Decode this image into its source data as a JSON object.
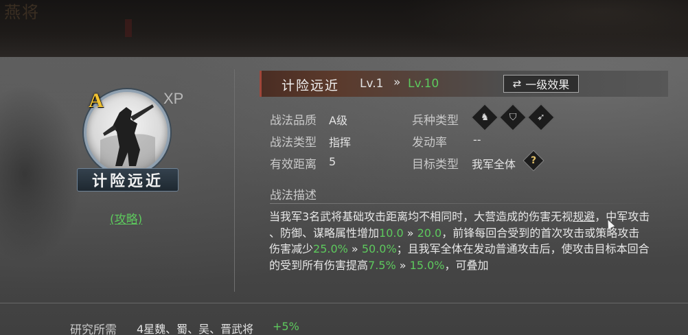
{
  "background": {
    "ghost_title": "燕将"
  },
  "skill": {
    "grade_letter": "A",
    "xp_label": "XP",
    "name": "计险远近",
    "guide_link": "(攻略)"
  },
  "header": {
    "title": "计险远近",
    "level_current": "Lv.1",
    "level_arrow": "»",
    "level_max": "Lv.10",
    "effect_button": {
      "icon": "swap-icon",
      "glyph": "⇄",
      "label": "一级效果"
    }
  },
  "attributes": {
    "quality_label": "战法品质",
    "quality_value": "A级",
    "type_label": "战法类型",
    "type_value": "指挥",
    "range_label": "有效距离",
    "range_value": "5",
    "troop_label": "兵种类型",
    "troop_icons": [
      {
        "name": "cavalry-icon",
        "glyph": "♞"
      },
      {
        "name": "shield-icon",
        "glyph": "⛉"
      },
      {
        "name": "bow-icon",
        "glyph": "➶"
      }
    ],
    "rate_label": "发动率",
    "rate_value": "--",
    "target_label": "目标类型",
    "target_value": "我军全体",
    "help_glyph": "?"
  },
  "description": {
    "title": "战法描述",
    "lines": [
      [
        {
          "t": "当我军3名武将基础攻击距离均不相同时，大营造成的伤害无视",
          "c": "n"
        },
        {
          "t": "规避",
          "c": "u"
        },
        {
          "t": "，中军攻击",
          "c": "n"
        }
      ],
      [
        {
          "t": "、防御、谋略属性增加",
          "c": "n"
        },
        {
          "t": "10.0",
          "c": "g"
        },
        {
          "t": " » ",
          "c": "n"
        },
        {
          "t": "20.0",
          "c": "g"
        },
        {
          "t": "，前锋每回合受到的首次攻击或策略攻击",
          "c": "n"
        }
      ],
      [
        {
          "t": "伤害减少",
          "c": "n"
        },
        {
          "t": "25.0%",
          "c": "g"
        },
        {
          "t": " » ",
          "c": "n"
        },
        {
          "t": "50.0%",
          "c": "g"
        },
        {
          "t": "；且我军全体在发动普通攻击后，使攻击目标本回合",
          "c": "n"
        }
      ],
      [
        {
          "t": "的受到所有伤害提高",
          "c": "n"
        },
        {
          "t": "7.5%",
          "c": "g"
        },
        {
          "t": " » ",
          "c": "n"
        },
        {
          "t": "15.0%",
          "c": "g"
        },
        {
          "t": "，可叠加",
          "c": "n"
        }
      ]
    ]
  },
  "research": {
    "label": "研究所需",
    "value": "4星魏、蜀、吴、晋武将",
    "bonus": "+5%"
  },
  "colors": {
    "accent_green": "#5dc95d",
    "grade_gold": "#f1c232",
    "header_red": "#a0463a"
  }
}
